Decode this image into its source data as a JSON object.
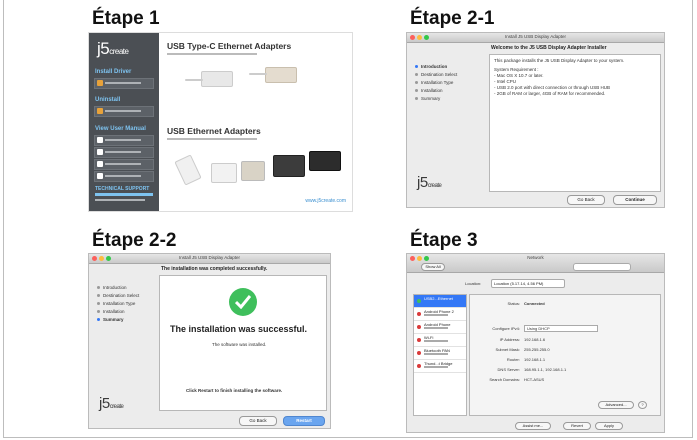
{
  "steps": {
    "s1": "Étape 1",
    "s2": "Étape 2-1",
    "s3": "Étape 2-2",
    "s4": "Étape 3"
  },
  "shot1": {
    "logo": "j5",
    "logo_suffix": "create",
    "sidebar": {
      "install_title": "Install Driver",
      "uninstall_title": "Uninstall",
      "manual_title": "View User Manual",
      "support_title": "TECHNICAL SUPPORT"
    },
    "heading_typec": "USB Type-C Ethernet Adapters",
    "heading_usb": "USB Ethernet Adapters",
    "url": "www.j5create.com"
  },
  "shot2": {
    "window_title": "Install J5 USB Display Adapter",
    "header": "Welcome to the J5 USB Display Adapter Installer",
    "steps": [
      "Introduction",
      "Destination Select",
      "Installation Type",
      "Installation",
      "Summary"
    ],
    "active_step": 0,
    "body_line1": "This package installs the J5 USB Display Adapter to your system.",
    "req_title": "System Requirement :",
    "req_lines": [
      "- Mac OS X 10.7 or later.",
      "- Intel CPU",
      "- USB 2.0 port with direct connection or through USB HUB",
      "- 2GB of RAM or larger, 4GB of RAM for recommended."
    ],
    "logo": "j5",
    "logo_suffix": "create",
    "back_label": "Go Back",
    "continue_label": "Continue"
  },
  "shot3": {
    "window_title": "Install J5 USB Display Adapter",
    "header": "The installation was completed successfully.",
    "steps": [
      "Introduction",
      "Destination Select",
      "Installation Type",
      "Installation",
      "Summary"
    ],
    "active_step": 4,
    "success": "The installation was successful.",
    "installed": "The software was installed.",
    "restart_hint": "Click Restart to finish installing the software.",
    "logo": "j5",
    "logo_suffix": "create",
    "back_label": "Go Back",
    "restart_label": "Restart"
  },
  "shot4": {
    "window_title": "Network",
    "show_all": "Show All",
    "location_label": "Location:",
    "location_value": "Location (5.17.14, 4.56 PM)",
    "services": [
      {
        "name": "USB2...Ethernet",
        "color": "#3fbf5c"
      },
      {
        "name": "Android Phone 2",
        "color": "#d93a3a"
      },
      {
        "name": "Android Phone",
        "color": "#d93a3a"
      },
      {
        "name": "Wi-Fi",
        "color": "#d93a3a"
      },
      {
        "name": "Bluetooth PAN",
        "color": "#d93a3a"
      },
      {
        "name": "Thund...t Bridge",
        "color": "#d93a3a"
      }
    ],
    "status_label": "Status:",
    "status_value": "Connected",
    "configure_label": "Configure IPv4:",
    "configure_value": "Using DHCP",
    "ip_label": "IP Address:",
    "ip_value": "192.168.1.6",
    "mask_label": "Subnet Mask:",
    "mask_value": "255.255.255.0",
    "router_label": "Router:",
    "router_value": "192.168.1.1",
    "dns_label": "DNS Server:",
    "dns_value": "168.95.1.1, 192.168.1.1",
    "search_label": "Search Domains:",
    "search_value": "HCT-ASUS",
    "advanced_label": "Advanced...",
    "assist_label": "Assist me...",
    "revert_label": "Revert",
    "apply_label": "Apply"
  }
}
